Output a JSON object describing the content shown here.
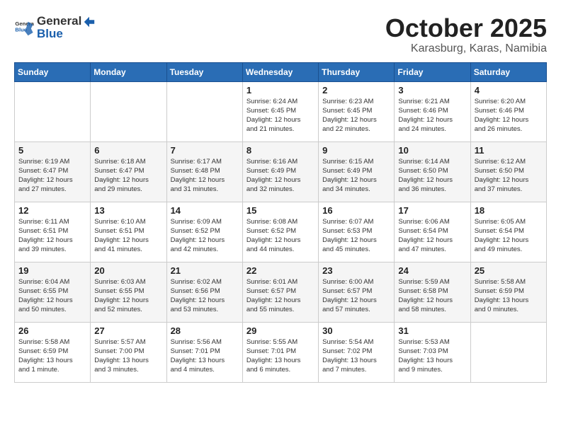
{
  "logo": {
    "general": "General",
    "blue": "Blue"
  },
  "header": {
    "month": "October 2025",
    "location": "Karasburg, Karas, Namibia"
  },
  "weekdays": [
    "Sunday",
    "Monday",
    "Tuesday",
    "Wednesday",
    "Thursday",
    "Friday",
    "Saturday"
  ],
  "weeks": [
    [
      {
        "day": "",
        "info": ""
      },
      {
        "day": "",
        "info": ""
      },
      {
        "day": "",
        "info": ""
      },
      {
        "day": "1",
        "info": "Sunrise: 6:24 AM\nSunset: 6:45 PM\nDaylight: 12 hours\nand 21 minutes."
      },
      {
        "day": "2",
        "info": "Sunrise: 6:23 AM\nSunset: 6:45 PM\nDaylight: 12 hours\nand 22 minutes."
      },
      {
        "day": "3",
        "info": "Sunrise: 6:21 AM\nSunset: 6:46 PM\nDaylight: 12 hours\nand 24 minutes."
      },
      {
        "day": "4",
        "info": "Sunrise: 6:20 AM\nSunset: 6:46 PM\nDaylight: 12 hours\nand 26 minutes."
      }
    ],
    [
      {
        "day": "5",
        "info": "Sunrise: 6:19 AM\nSunset: 6:47 PM\nDaylight: 12 hours\nand 27 minutes."
      },
      {
        "day": "6",
        "info": "Sunrise: 6:18 AM\nSunset: 6:47 PM\nDaylight: 12 hours\nand 29 minutes."
      },
      {
        "day": "7",
        "info": "Sunrise: 6:17 AM\nSunset: 6:48 PM\nDaylight: 12 hours\nand 31 minutes."
      },
      {
        "day": "8",
        "info": "Sunrise: 6:16 AM\nSunset: 6:49 PM\nDaylight: 12 hours\nand 32 minutes."
      },
      {
        "day": "9",
        "info": "Sunrise: 6:15 AM\nSunset: 6:49 PM\nDaylight: 12 hours\nand 34 minutes."
      },
      {
        "day": "10",
        "info": "Sunrise: 6:14 AM\nSunset: 6:50 PM\nDaylight: 12 hours\nand 36 minutes."
      },
      {
        "day": "11",
        "info": "Sunrise: 6:12 AM\nSunset: 6:50 PM\nDaylight: 12 hours\nand 37 minutes."
      }
    ],
    [
      {
        "day": "12",
        "info": "Sunrise: 6:11 AM\nSunset: 6:51 PM\nDaylight: 12 hours\nand 39 minutes."
      },
      {
        "day": "13",
        "info": "Sunrise: 6:10 AM\nSunset: 6:51 PM\nDaylight: 12 hours\nand 41 minutes."
      },
      {
        "day": "14",
        "info": "Sunrise: 6:09 AM\nSunset: 6:52 PM\nDaylight: 12 hours\nand 42 minutes."
      },
      {
        "day": "15",
        "info": "Sunrise: 6:08 AM\nSunset: 6:52 PM\nDaylight: 12 hours\nand 44 minutes."
      },
      {
        "day": "16",
        "info": "Sunrise: 6:07 AM\nSunset: 6:53 PM\nDaylight: 12 hours\nand 45 minutes."
      },
      {
        "day": "17",
        "info": "Sunrise: 6:06 AM\nSunset: 6:54 PM\nDaylight: 12 hours\nand 47 minutes."
      },
      {
        "day": "18",
        "info": "Sunrise: 6:05 AM\nSunset: 6:54 PM\nDaylight: 12 hours\nand 49 minutes."
      }
    ],
    [
      {
        "day": "19",
        "info": "Sunrise: 6:04 AM\nSunset: 6:55 PM\nDaylight: 12 hours\nand 50 minutes."
      },
      {
        "day": "20",
        "info": "Sunrise: 6:03 AM\nSunset: 6:55 PM\nDaylight: 12 hours\nand 52 minutes."
      },
      {
        "day": "21",
        "info": "Sunrise: 6:02 AM\nSunset: 6:56 PM\nDaylight: 12 hours\nand 53 minutes."
      },
      {
        "day": "22",
        "info": "Sunrise: 6:01 AM\nSunset: 6:57 PM\nDaylight: 12 hours\nand 55 minutes."
      },
      {
        "day": "23",
        "info": "Sunrise: 6:00 AM\nSunset: 6:57 PM\nDaylight: 12 hours\nand 57 minutes."
      },
      {
        "day": "24",
        "info": "Sunrise: 5:59 AM\nSunset: 6:58 PM\nDaylight: 12 hours\nand 58 minutes."
      },
      {
        "day": "25",
        "info": "Sunrise: 5:58 AM\nSunset: 6:59 PM\nDaylight: 13 hours\nand 0 minutes."
      }
    ],
    [
      {
        "day": "26",
        "info": "Sunrise: 5:58 AM\nSunset: 6:59 PM\nDaylight: 13 hours\nand 1 minute."
      },
      {
        "day": "27",
        "info": "Sunrise: 5:57 AM\nSunset: 7:00 PM\nDaylight: 13 hours\nand 3 minutes."
      },
      {
        "day": "28",
        "info": "Sunrise: 5:56 AM\nSunset: 7:01 PM\nDaylight: 13 hours\nand 4 minutes."
      },
      {
        "day": "29",
        "info": "Sunrise: 5:55 AM\nSunset: 7:01 PM\nDaylight: 13 hours\nand 6 minutes."
      },
      {
        "day": "30",
        "info": "Sunrise: 5:54 AM\nSunset: 7:02 PM\nDaylight: 13 hours\nand 7 minutes."
      },
      {
        "day": "31",
        "info": "Sunrise: 5:53 AM\nSunset: 7:03 PM\nDaylight: 13 hours\nand 9 minutes."
      },
      {
        "day": "",
        "info": ""
      }
    ]
  ]
}
